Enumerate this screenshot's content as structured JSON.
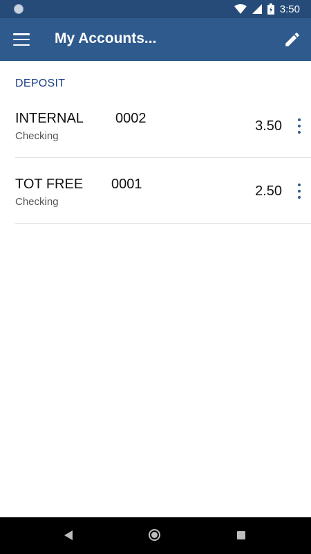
{
  "status_bar": {
    "time": "3:50"
  },
  "app_bar": {
    "title": "My Accounts..."
  },
  "section": {
    "header": "DEPOSIT"
  },
  "accounts": [
    {
      "name": "INTERNAL",
      "number": "0002",
      "type": "Checking",
      "balance": "3.50"
    },
    {
      "name": "TOT FREE",
      "number": "0001",
      "type": "Checking",
      "balance": "2.50"
    }
  ],
  "colors": {
    "status_bar": "#264b79",
    "app_bar": "#2f5a8d",
    "section_header": "#1a3d8a",
    "nav_bar": "#000000"
  },
  "icons": {
    "menu": "hamburger-icon",
    "edit": "pencil-icon",
    "more": "more-vertical-icon",
    "wifi": "wifi-icon",
    "signal": "signal-icon",
    "battery": "battery-charging-icon"
  }
}
